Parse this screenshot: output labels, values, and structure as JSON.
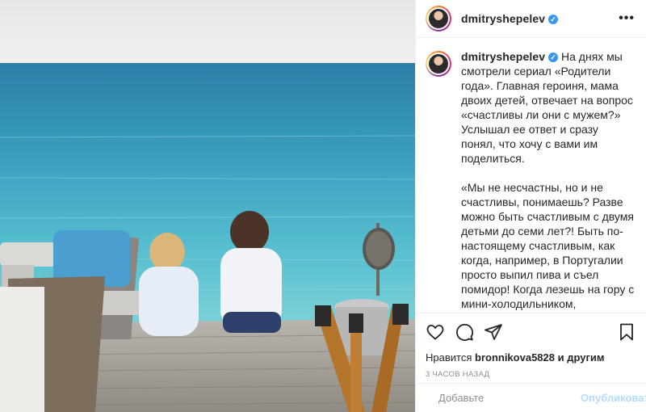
{
  "post": {
    "username": "dmitryshepelev",
    "verified_mark": "✓",
    "more_label": "•••",
    "caption": "На днях мы смотрели сериал «Родители года». Главная героиня, мама двоих детей, отвечает на вопрос «счастливы ли они с мужем?» Услышал ее ответ и сразу понял, что хочу с вами им поделиться.\n\n«Мы не несчастны, но и не счастливы, понимаешь? Разве можно быть счастливым с двумя детьми до семи лет?! Быть по-настоящему счастливым, как когда, например, в Португалии просто выпил пива и съел помидор! Когда лезешь на гору с мини-холодильником, привязанным к тебе бельевой веревкой?! Когда ты тащишь мини-холодильник - ты не можешь быть счастлив. Добраться до вершины"
  },
  "likes": {
    "prefix": "Нравится",
    "user": "bronnikova5828",
    "suffix": "и другим"
  },
  "time_ago": "3 ЧАСОВ НАЗАД",
  "comment_box": {
    "placeholder": "Добавьте",
    "publish_label": "Опубликовать"
  },
  "icons": {
    "like": "heart-icon",
    "comment": "comment-icon",
    "share": "paper-plane-icon",
    "save": "bookmark-icon",
    "emoji": "smiley-icon",
    "more": "more-dots-icon"
  },
  "colors": {
    "verified": "#3897f0",
    "publish": "#b3dbff",
    "sea": "#4fb8cc",
    "deck": "#a9a49d"
  }
}
